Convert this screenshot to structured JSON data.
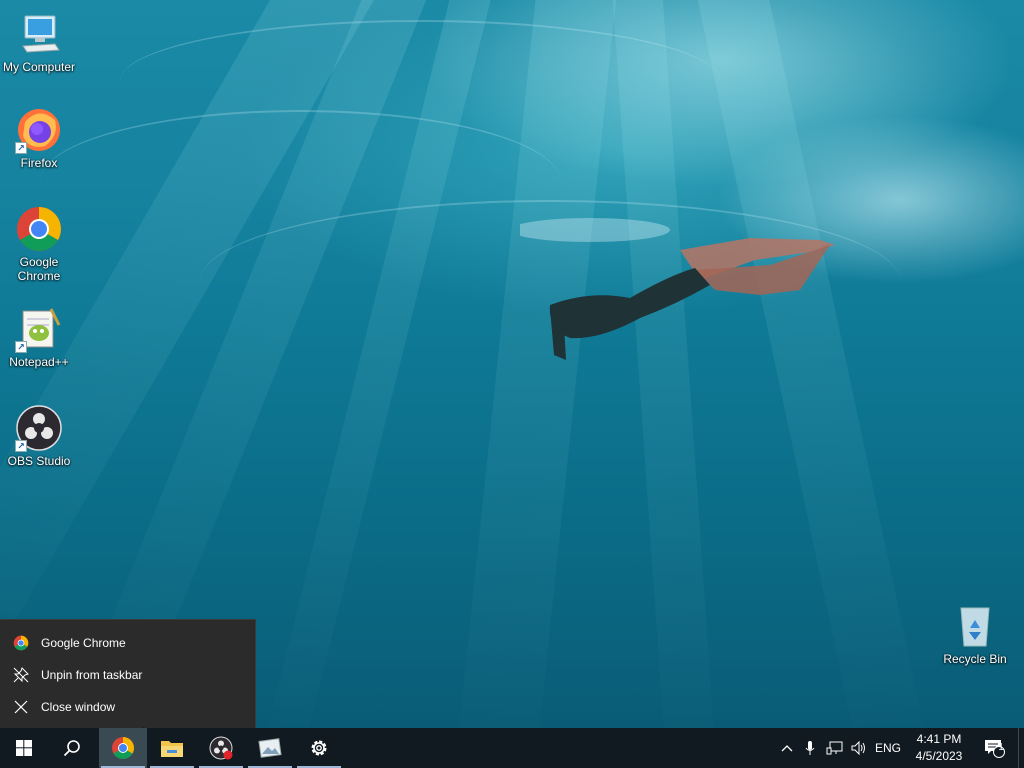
{
  "desktop": {
    "icons": [
      {
        "label": "My Computer",
        "icon": "computer-icon"
      },
      {
        "label": "Firefox",
        "icon": "firefox-icon"
      },
      {
        "label": "Google\nChrome",
        "icon": "chrome-icon"
      },
      {
        "label": "Notepad++",
        "icon": "notepad-plus-plus-icon"
      },
      {
        "label": "OBS Studio",
        "icon": "obs-icon"
      },
      {
        "label": "Recycle Bin",
        "icon": "recycle-bin-icon"
      }
    ]
  },
  "context_menu": {
    "items": [
      {
        "label": "Google Chrome",
        "icon": "chrome-icon"
      },
      {
        "label": "Unpin from taskbar",
        "icon": "unpin-icon"
      },
      {
        "label": "Close window",
        "icon": "close-icon"
      }
    ]
  },
  "taskbar": {
    "apps": [
      {
        "name": "start",
        "icon": "windows-logo-icon"
      },
      {
        "name": "search",
        "icon": "search-icon"
      },
      {
        "name": "chrome",
        "icon": "chrome-icon",
        "active": true
      },
      {
        "name": "file-explorer",
        "icon": "folder-icon"
      },
      {
        "name": "obs",
        "icon": "obs-icon"
      },
      {
        "name": "photos",
        "icon": "image-viewer-icon"
      },
      {
        "name": "settings",
        "icon": "gear-icon"
      }
    ],
    "tray": {
      "language": "ENG",
      "time": "4:41 PM",
      "date": "4/5/2023",
      "notification_count": "1"
    }
  },
  "colors": {
    "taskbar_bg": "#101a20",
    "menu_bg": "#2b2b2b",
    "accent_underline": "#9fb8d8"
  }
}
